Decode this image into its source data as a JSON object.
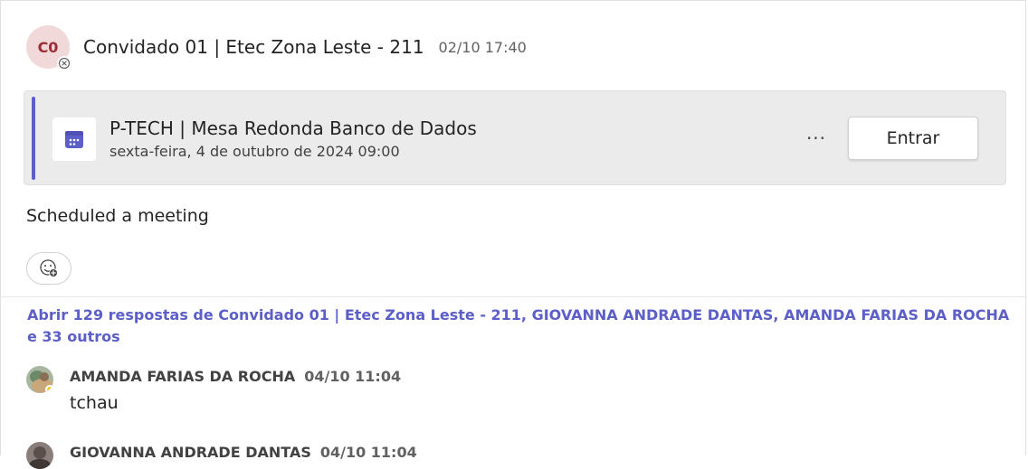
{
  "post": {
    "avatar_initials": "C0",
    "author": "Convidado 01 | Etec Zona Leste - 211",
    "timestamp": "02/10 17:40",
    "message": "Scheduled a meeting"
  },
  "meeting": {
    "title": "P-TECH | Mesa Redonda Banco de Dados",
    "date": "sexta-feira, 4 de outubro de 2024 09:00",
    "more_label": "···",
    "join_label": "Entrar",
    "accent_color": "#5b5fc7",
    "icon": "calendar-icon"
  },
  "replies_link": "Abrir 129 respostas de Convidado 01 | Etec Zona Leste - 211, GIOVANNA ANDRADE DANTAS, AMANDA FARIAS DA ROCHA e 33 outros",
  "replies": [
    {
      "author": "AMANDA FARIAS DA ROCHA",
      "time": "04/10 11:04",
      "text": "tchau"
    },
    {
      "author": "GIOVANNA ANDRADE DANTAS",
      "time": "04/10 11:04",
      "text": ""
    }
  ]
}
